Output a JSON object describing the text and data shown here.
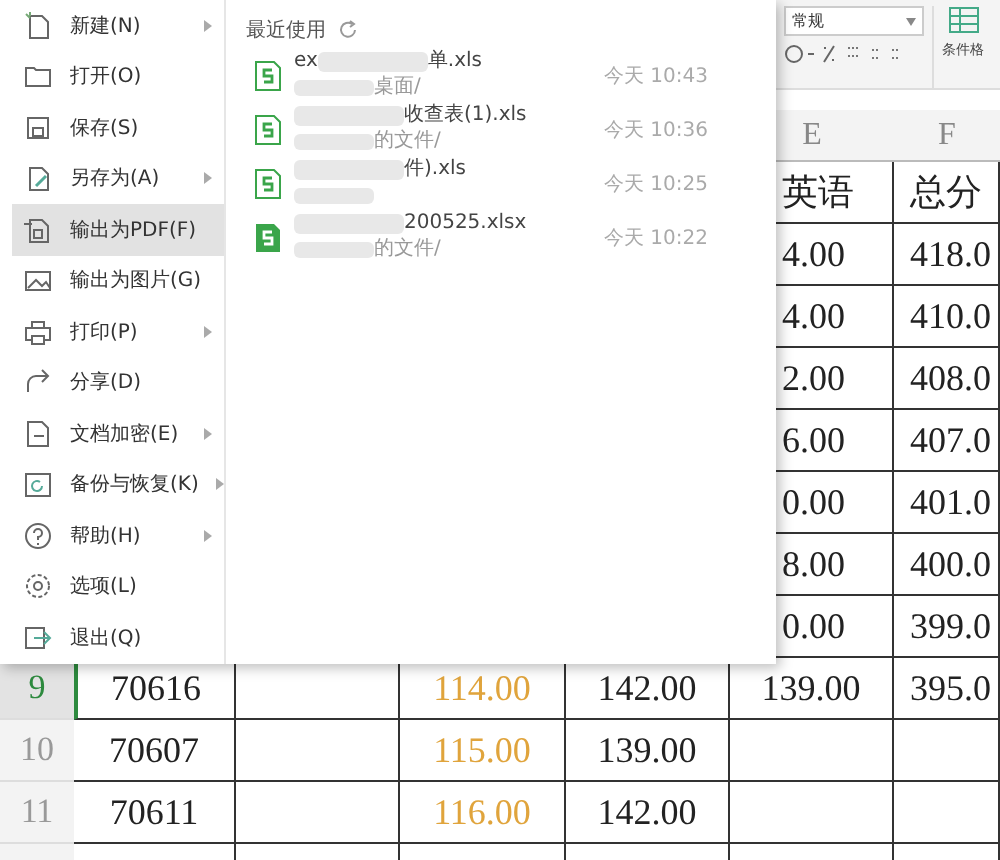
{
  "sheet": {
    "ribbon": {
      "number_format": "常规",
      "conditional_format": "条件格"
    },
    "column_headers": [
      "E",
      "F"
    ],
    "covered_rows": [
      {
        "e": "英语",
        "f": "总分"
      },
      {
        "e": "4.00",
        "f": "418.0"
      },
      {
        "e": "4.00",
        "f": "410.0"
      },
      {
        "e": "2.00",
        "f": "408.0"
      },
      {
        "e": "6.00",
        "f": "407.0"
      },
      {
        "e": "0.00",
        "f": "401.0"
      },
      {
        "e": "8.00",
        "f": "400.0"
      },
      {
        "e": "0.00",
        "f": "399.0"
      }
    ],
    "rows": [
      {
        "number": "9",
        "selected": true,
        "col_a": "70616",
        "col_c": "114.00",
        "col_d": "142.00",
        "col_e": "139.00",
        "col_f": "395.0"
      },
      {
        "number": "10",
        "selected": false,
        "col_a": "70607",
        "col_c": "115.00",
        "col_d": "139.00"
      },
      {
        "number": "11",
        "selected": false,
        "col_a": "70611",
        "col_c": "116.00",
        "col_d": "142.00"
      }
    ]
  },
  "file_menu": {
    "items": [
      {
        "label": "新建(N)",
        "submenu": true,
        "selected": false
      },
      {
        "label": "打开(O)",
        "submenu": false,
        "selected": false
      },
      {
        "label": "保存(S)",
        "submenu": false,
        "selected": false
      },
      {
        "label": "另存为(A)",
        "submenu": true,
        "selected": false
      },
      {
        "label": "输出为PDF(F)",
        "submenu": false,
        "selected": true
      },
      {
        "label": "输出为图片(G)",
        "submenu": false,
        "selected": false
      },
      {
        "label": "打印(P)",
        "submenu": true,
        "selected": false
      },
      {
        "label": "分享(D)",
        "submenu": false,
        "selected": false
      },
      {
        "label": "文档加密(E)",
        "submenu": true,
        "selected": false
      },
      {
        "label": "备份与恢复(K)",
        "submenu": true,
        "selected": false
      },
      {
        "label": "帮助(H)",
        "submenu": true,
        "selected": false
      },
      {
        "label": "选项(L)",
        "submenu": false,
        "selected": false
      },
      {
        "label": "退出(Q)",
        "submenu": false,
        "selected": false
      }
    ],
    "recent": {
      "title": "最近使用",
      "files": [
        {
          "kind": "xls",
          "name_head": "ex",
          "name": "单.xls",
          "path": "桌面/",
          "time": "今天 10:43"
        },
        {
          "kind": "xls",
          "name": "收查表(1).xls",
          "path": "的文件/",
          "time": "今天 10:36"
        },
        {
          "kind": "xls",
          "name": "件).xls",
          "time": "今天 10:25"
        },
        {
          "kind": "xlsx",
          "name": "200525.xlsx",
          "path": "的文件/",
          "time": "今天 10:22"
        }
      ]
    }
  }
}
